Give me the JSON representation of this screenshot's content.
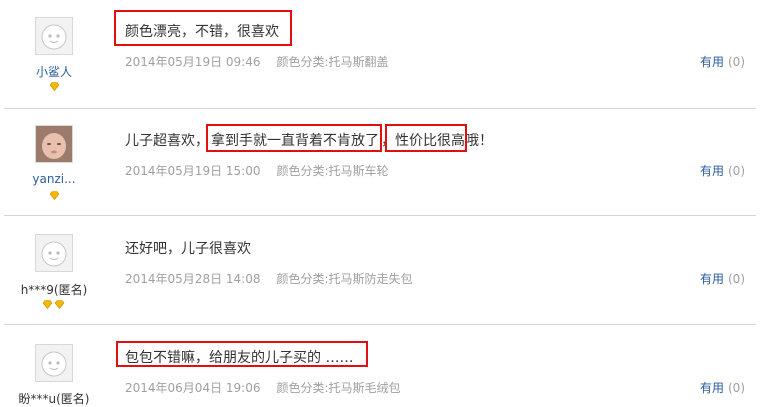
{
  "reviews": [
    {
      "username": "小鲨人",
      "text_parts": [
        "颜色漂亮，不错，很喜欢"
      ],
      "date": "2014年05月19日 09:46",
      "color_category": "颜色分类:托马斯翻盖",
      "helpful_label": "有用",
      "helpful_count": "(0)",
      "badge_count": 1
    },
    {
      "username": "yanzi...",
      "text_parts": [
        "儿子超喜欢，",
        "拿到手就一直背着不肯放了",
        "，",
        "性价比很高",
        "哦",
        "！"
      ],
      "date": "2014年05月19日 15:00",
      "color_category": "颜色分类:托马斯车轮",
      "helpful_label": "有用",
      "helpful_count": "(0)",
      "badge_count": 1
    },
    {
      "username": "h***9(匿名)",
      "text_parts": [
        "还好吧，儿子很喜欢"
      ],
      "date": "2014年05月28日 14:08",
      "color_category": "颜色分类:托马斯防走失包",
      "helpful_label": "有用",
      "helpful_count": "(0)",
      "badge_count": 2
    },
    {
      "username": "盼***u(匿名)",
      "text_parts": [
        "包包不错嘛，给朋友的儿子买的 ……"
      ],
      "date": "2014年06月04日 19:06",
      "color_category": "颜色分类:托马斯毛绒包",
      "helpful_label": "有用",
      "helpful_count": "(0)",
      "badge_count": 0
    }
  ],
  "colors": {
    "highlight": "#e01010",
    "link": "#2a5d9f",
    "meta": "#a0a0a0",
    "badge": "#f5b800"
  }
}
